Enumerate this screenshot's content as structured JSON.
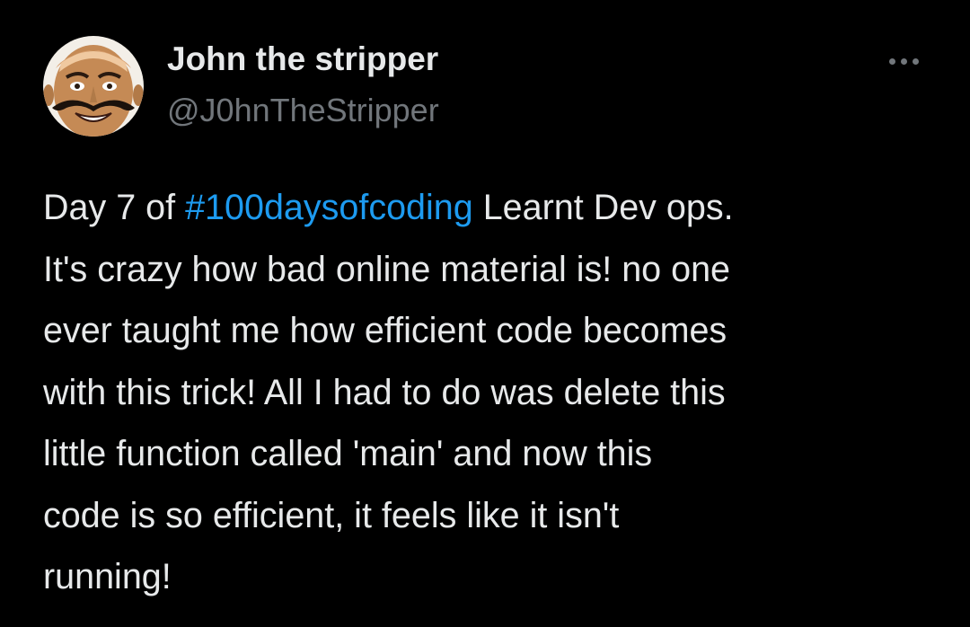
{
  "author": {
    "display_name": "John the stripper",
    "handle": "@J0hnTheStripper",
    "avatar_icon": "profile-photo-mustache-man"
  },
  "more_menu": {
    "icon": "more-horizontal-icon"
  },
  "tweet": {
    "line1_prefix": "Day 7 of ",
    "hashtag": "#100daysofcoding",
    "line1_suffix": "Learnt Dev ops.",
    "lines": [
      "It's crazy how bad online material is! no one",
      "ever taught me how efficient code becomes",
      "with this trick! All I had to do was delete this",
      "little function called 'main' and now this",
      "code is so efficient, it feels like it isn't",
      "running!"
    ]
  },
  "colors": {
    "background": "#000000",
    "text_primary": "#e7e9ea",
    "text_secondary": "#71767b",
    "link": "#1d9bf0"
  }
}
